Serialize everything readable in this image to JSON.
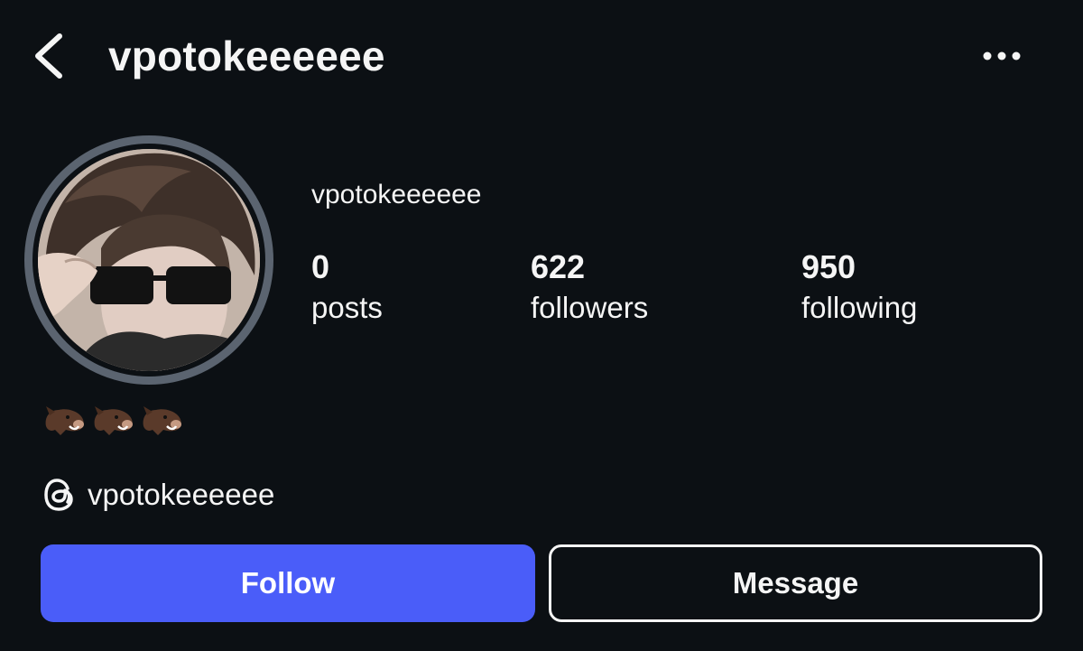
{
  "header": {
    "username": "vpotokeeeeee",
    "back_icon": "chevron-left-icon",
    "more_icon": "more-horizontal-icon"
  },
  "profile": {
    "display_name": "vpotokeeeeee",
    "avatar": "profile-photo",
    "stats": [
      {
        "count": "0",
        "label": "posts"
      },
      {
        "count": "622",
        "label": "followers"
      },
      {
        "count": "950",
        "label": "following"
      }
    ],
    "bio_emojis": [
      "boar-emoji",
      "boar-emoji",
      "boar-emoji"
    ],
    "threads": {
      "icon": "threads-icon",
      "handle": "vpotokeeeeee"
    }
  },
  "actions": {
    "follow_label": "Follow",
    "message_label": "Message"
  },
  "colors": {
    "background": "#0c1014",
    "follow_button": "#4a5df9",
    "text": "#f5f5f5",
    "avatar_ring": "#5b6470"
  }
}
